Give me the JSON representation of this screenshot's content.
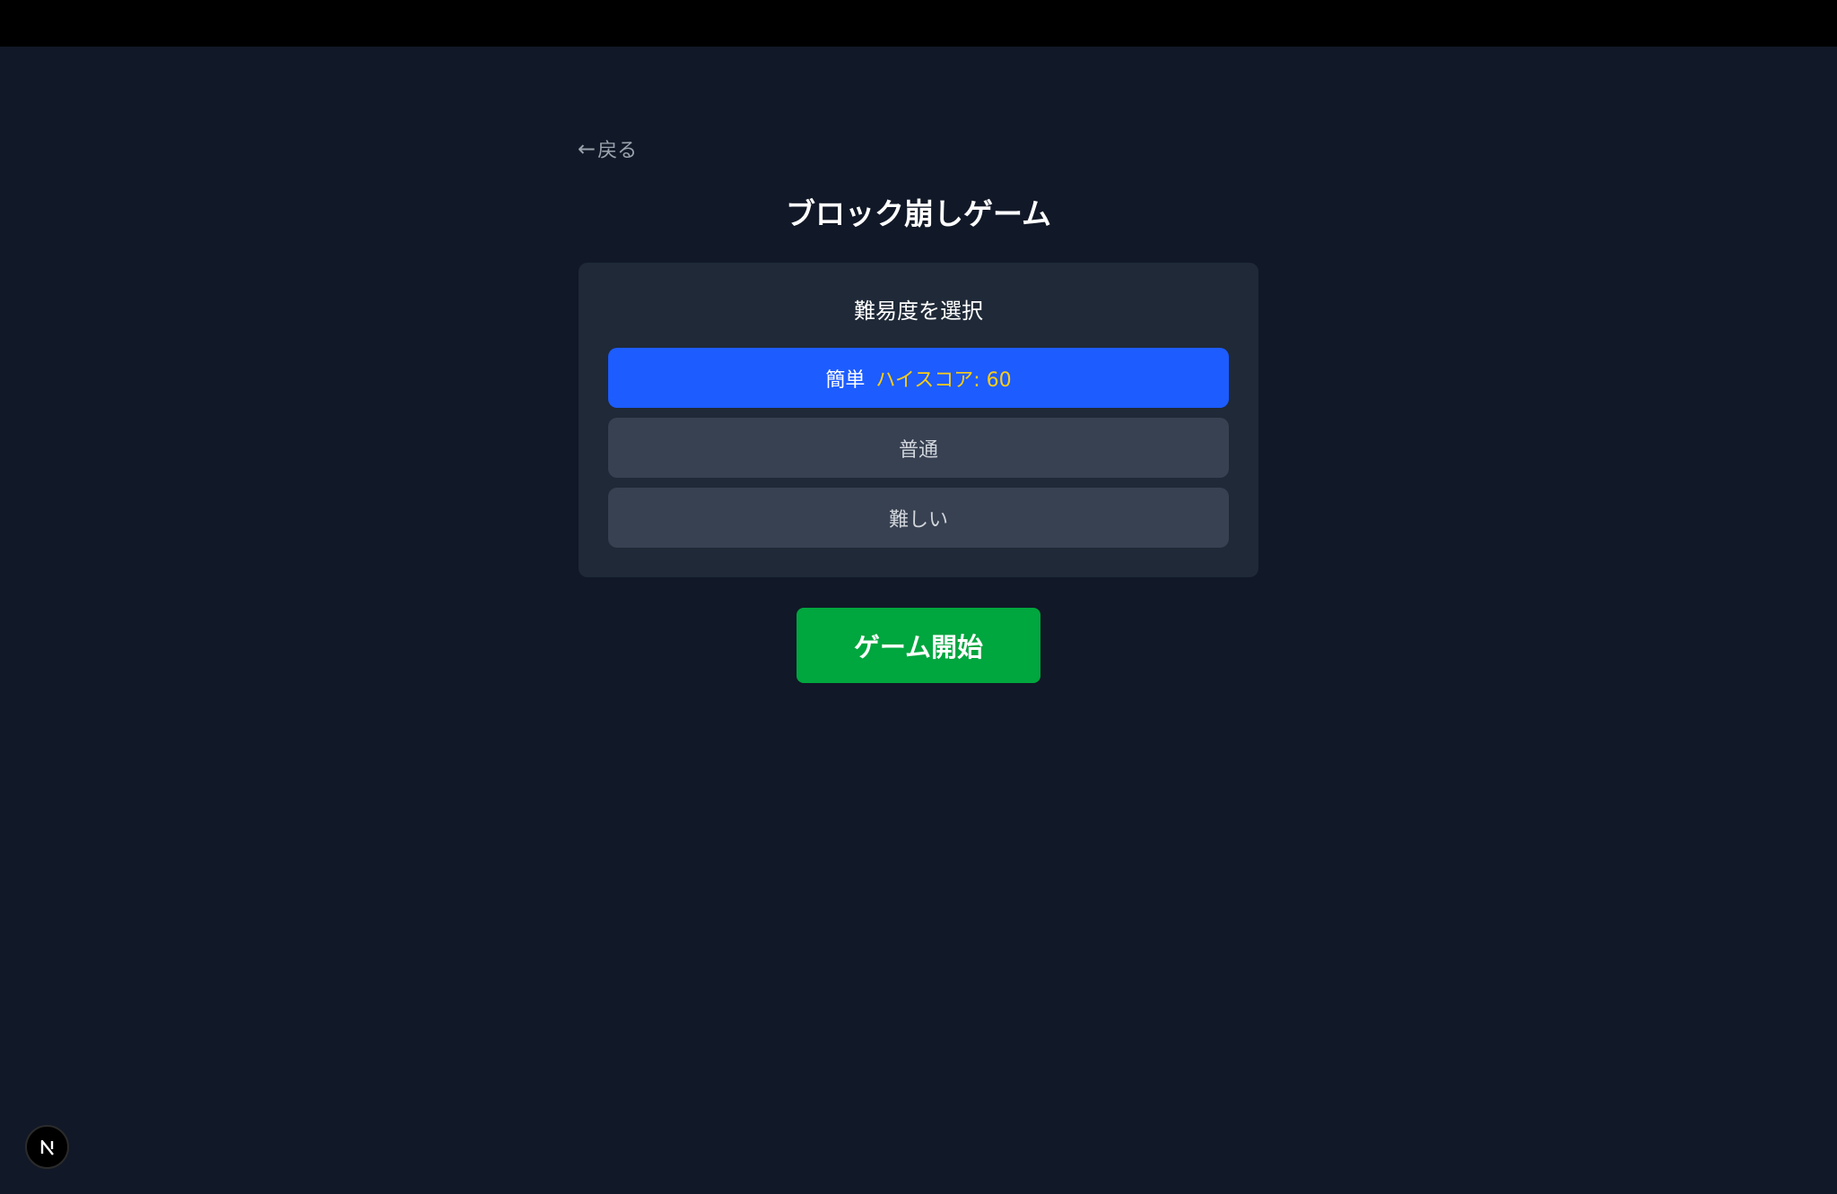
{
  "nav": {
    "back_label": "戻る"
  },
  "title": "ブロック崩しゲーム",
  "difficulty": {
    "heading": "難易度を選択",
    "options": [
      {
        "label": "簡単",
        "high_score_text": "ハイスコア: 60",
        "selected": true
      },
      {
        "label": "普通",
        "selected": false
      },
      {
        "label": "難しい",
        "selected": false
      }
    ]
  },
  "start_button": {
    "label": "ゲーム開始"
  },
  "dev_badge": {
    "letter": "N",
    "icon": "nextjs-logo-icon"
  },
  "colors": {
    "background": "#111827",
    "panel": "#1f2937",
    "option": "#374151",
    "selected": "#1d5cff",
    "high_score": "#facc15",
    "start": "#00a63e"
  }
}
